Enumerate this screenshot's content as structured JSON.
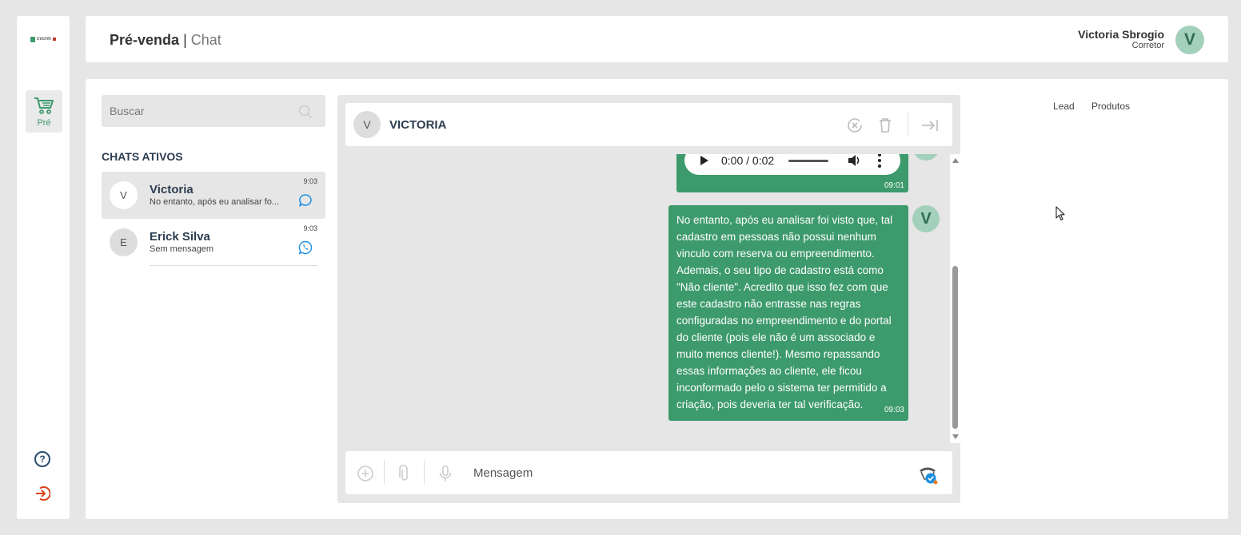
{
  "header": {
    "title_main": "Pré-venda",
    "title_sep": "|",
    "title_sub": "Chat",
    "user_name": "Victoria Sbrogio",
    "user_role": "Corretor",
    "user_initial": "V"
  },
  "sidebar": {
    "logo_text": "cvcrm",
    "active_item_label": "Pré"
  },
  "search": {
    "placeholder": "Buscar"
  },
  "chats": {
    "section_title": "CHATS ATIVOS",
    "items": [
      {
        "initial": "V",
        "name": "Victoria",
        "preview": "No entanto, após eu analisar fo...",
        "time": "9:03",
        "channel": "chat-icon"
      },
      {
        "initial": "E",
        "name": "Erick Silva",
        "preview": "Sem mensagem",
        "time": "9:03",
        "channel": "whatsapp-icon"
      }
    ]
  },
  "conversation": {
    "contact_initial": "V",
    "contact_name": "VICTORIA",
    "audio": {
      "time": "0:00 / 0:02",
      "stamp": "09:01"
    },
    "message": {
      "lines": [
        "No entanto, após eu analisar foi visto que, tal",
        "cadastro em pessoas não possui nenhum",
        "vinculo com reserva ou empreendimento.",
        "Ademais, o seu tipo de cadastro está como",
        "\"Não cliente\". Acredito que isso fez com que",
        "este cadastro não entrasse nas regras",
        "configuradas no empreendimento e do portal",
        "do cliente (pois ele não é um associado e",
        "muito menos cliente!). Mesmo repassando",
        "essas informações ao cliente, ele ficou",
        "inconformado pelo o sistema ter permitido a",
        "criação, pois deveria ter tal verificação."
      ],
      "stamp": "09:03",
      "sender_initial": "V"
    },
    "composer_placeholder": "Mensagem"
  },
  "right_tabs": [
    "Lead",
    "Produtos"
  ],
  "colors": {
    "accent": "#3d9a6c",
    "avatar_bg": "#a3d0bb",
    "heading": "#2d3e50"
  }
}
